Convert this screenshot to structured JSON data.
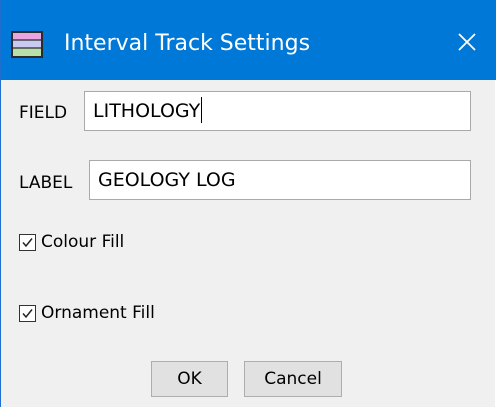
{
  "window": {
    "title": "Interval Track Settings",
    "accent_color": "#0078d7",
    "icon": "app-window-icon",
    "close_icon": "close-icon"
  },
  "form": {
    "field": {
      "label": "FIELD",
      "value": "LITHOLOGY"
    },
    "label_row": {
      "label": "LABEL",
      "value": "GEOLOGY LOG"
    },
    "colour_fill": {
      "label": "Colour Fill",
      "checked": true
    },
    "ornament_fill": {
      "label": "Ornament Fill",
      "checked": true
    }
  },
  "buttons": {
    "ok": "OK",
    "cancel": "Cancel"
  }
}
